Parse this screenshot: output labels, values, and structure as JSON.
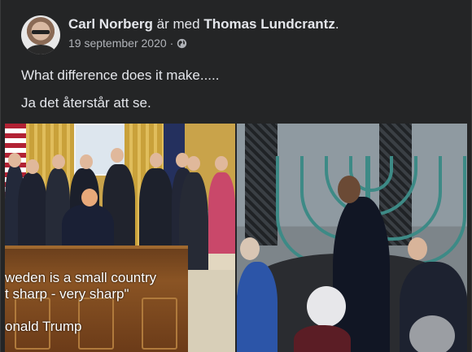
{
  "post": {
    "author": "Carl Norberg",
    "with_text": "är med",
    "tagged": "Thomas Lundcrantz",
    "period": ".",
    "date": "19 september 2020",
    "dot": "·",
    "privacy_icon": "globe-icon",
    "line1": "What difference does it make.....",
    "line2": "Ja det återstår att se."
  },
  "images": {
    "left": {
      "quote_line1": "weden is a small country",
      "quote_line2": "t sharp - very sharp\"",
      "quote_line3": "onald Trump"
    },
    "right": {}
  },
  "colors": {
    "background": "#242526",
    "text_primary": "#e4e6eb",
    "text_secondary": "#b0b3b8"
  }
}
